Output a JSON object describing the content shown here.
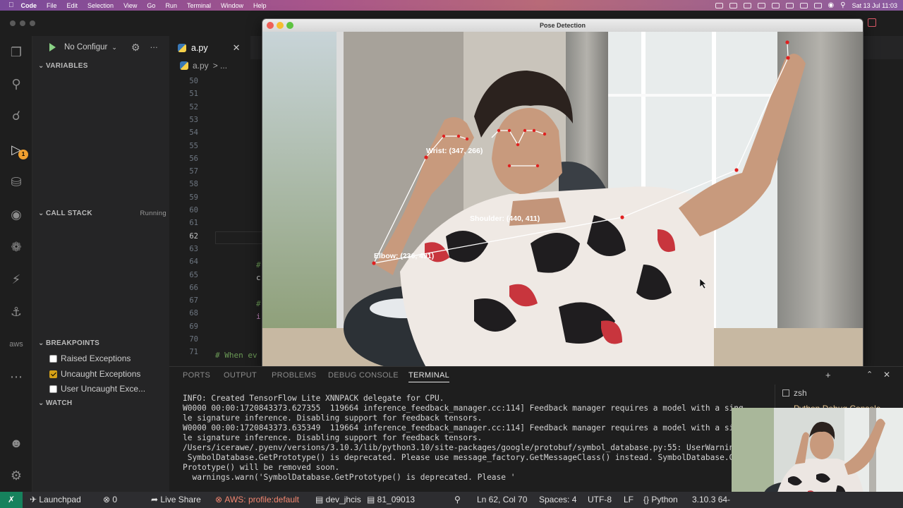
{
  "menubar": {
    "app": "Code",
    "items": [
      "File",
      "Edit",
      "Selection",
      "View",
      "Go",
      "Run",
      "Terminal",
      "Window",
      "Help"
    ],
    "clock": "Sat 13 Jul  11:03"
  },
  "debug": {
    "config_label": "No Configur",
    "sections": {
      "variables": "VARIABLES",
      "call_stack": "CALL STACK",
      "call_stack_state": "Running",
      "breakpoints": "BREAKPOINTS",
      "watch": "WATCH"
    },
    "breakpoints": [
      {
        "label": "Raised Exceptions",
        "checked": false
      },
      {
        "label": "Uncaught Exceptions",
        "checked": true
      },
      {
        "label": "User Uncaught Exce...",
        "checked": false
      }
    ],
    "run_badge": "1"
  },
  "editor": {
    "tab": "a.py",
    "breadcrumb_file": "a.py",
    "breadcrumb_rest": "> ...",
    "lines": [
      "50",
      "51",
      "52",
      "53",
      "54",
      "55",
      "56",
      "57",
      "58",
      "59",
      "60",
      "61",
      "62",
      "63",
      "64",
      "65",
      "66",
      "67",
      "68",
      "69",
      "70",
      "71"
    ],
    "current_line": "62",
    "code_fragments": {
      "l64": "#",
      "l65": "c",
      "l67": "#",
      "l68": "i",
      "l71": "# When ev"
    }
  },
  "pose_window": {
    "title": "Pose Detection",
    "labels": {
      "wrist": "Wrist: (347, 266)",
      "shoulder": "Shoulder: (440, 411)",
      "elbow": "Elbow: (236, 491)"
    }
  },
  "panel": {
    "tabs": [
      "PORTS",
      "OUTPUT",
      "PROBLEMS",
      "DEBUG CONSOLE",
      "TERMINAL"
    ],
    "active_tab": "TERMINAL",
    "terminal_lines": [
      "INFO: Created TensorFlow Lite XNNPACK delegate for CPU.",
      "W0000 00:00:1720843373.627355  119664 inference_feedback_manager.cc:114] Feedback manager requires a model with a sing",
      "le signature inference. Disabling support for feedback tensors.",
      "W0000 00:00:1720843373.635349  119664 inference_feedback_manager.cc:114] Feedback manager requires a model with a sin",
      "le signature inference. Disabling support for feedback tensors.",
      "/Users/icerawe/.pyenv/versions/3.10.3/lib/python3.10/site-packages/google/protobuf/symbol_database.py:55: UserWarning",
      " SymbolDatabase.GetPrototype() is deprecated. Please use message_factory.GetMessageClass() instead. SymbolDatabase.Ge",
      "Prototype() will be removed soon.",
      "  warnings.warn('SymbolDatabase.GetPrototype() is deprecated. Please '"
    ],
    "terminals": [
      "zsh",
      "Python Debug Console"
    ]
  },
  "statusbar": {
    "launchpad": "Launchpad",
    "errors": "0",
    "live_share": "Live Share",
    "aws": "AWS: profile:default",
    "branch": "dev_jhcis",
    "branch2": "81_09013",
    "position": "Ln 62, Col 70",
    "spaces": "Spaces: 4",
    "encoding": "UTF-8",
    "eol": "LF",
    "language": "Python",
    "version": "3.10.3 64-"
  }
}
